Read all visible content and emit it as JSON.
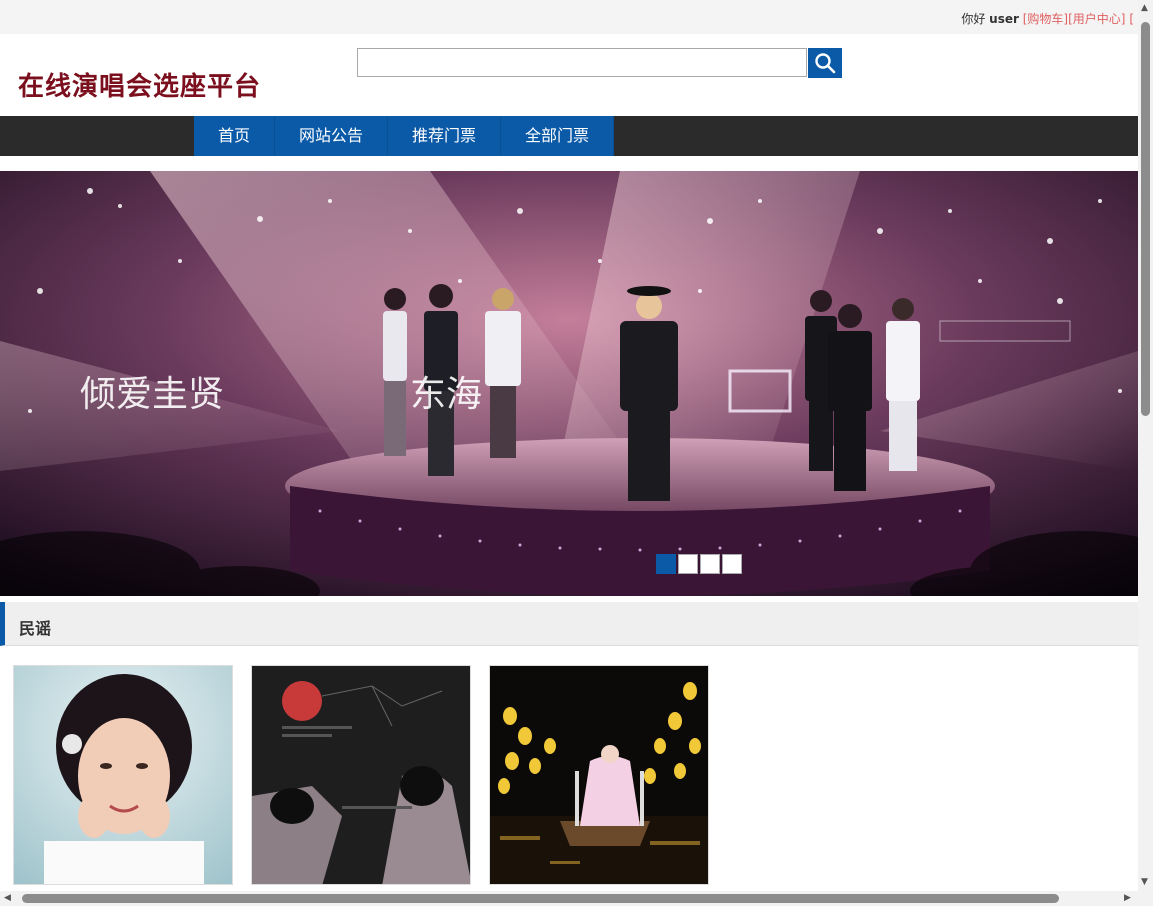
{
  "topbar": {
    "greeting": "你好 ",
    "username": "user",
    "cart_link": "[购物车]",
    "user_center_link": "[用户中心]",
    "trailing": "["
  },
  "header": {
    "site_title": "在线演唱会选座平台",
    "search_placeholder": ""
  },
  "nav": {
    "items": [
      "首页",
      "网站公告",
      "推荐门票",
      "全部门票"
    ]
  },
  "banner": {
    "captions": [
      "倾爱圭贤",
      "东海"
    ],
    "slide_count": 4,
    "active_slide": 1
  },
  "section": {
    "title": "民谣"
  },
  "colors": {
    "brand_blue": "#0a5aa8",
    "title_red": "#7b0f1d",
    "link_red": "#e06060",
    "nav_dark": "#2b2b2b"
  },
  "icons": {
    "search": "search-icon"
  }
}
